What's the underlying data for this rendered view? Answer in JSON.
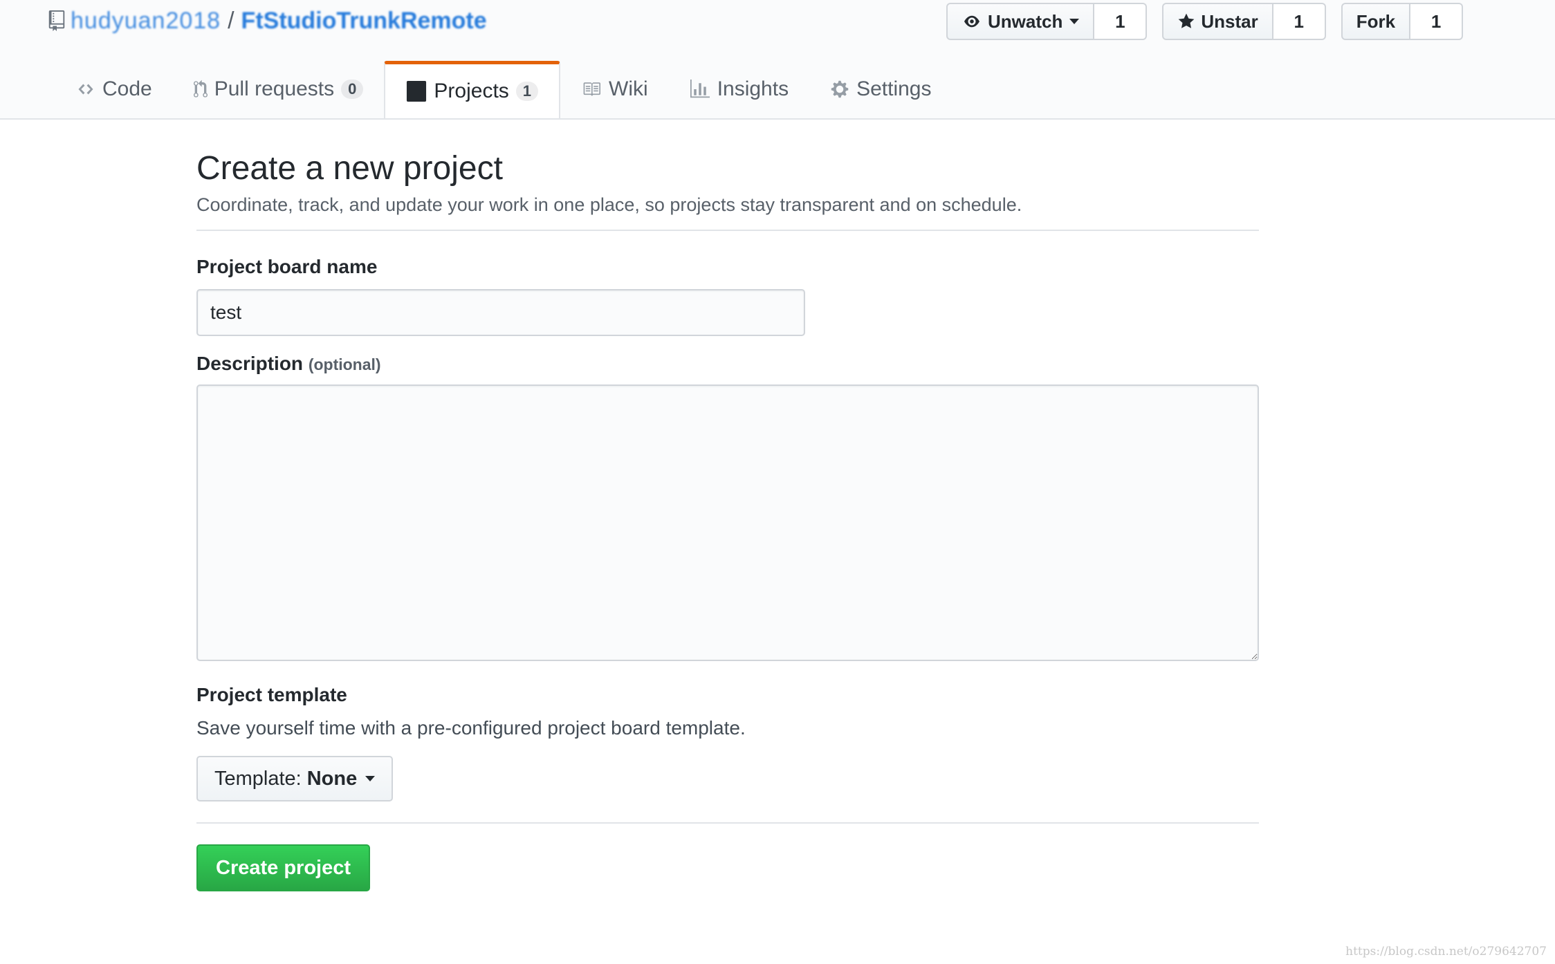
{
  "repo": {
    "owner": "hudyuan2018",
    "separator": "/",
    "name": "FtStudioTrunkRemote"
  },
  "actions": {
    "watch": {
      "label": "Unwatch",
      "count": "1"
    },
    "star": {
      "label": "Unstar",
      "count": "1"
    },
    "fork": {
      "label": "Fork",
      "count": "1"
    }
  },
  "tabs": [
    {
      "label": "Code"
    },
    {
      "label": "Pull requests",
      "count": "0"
    },
    {
      "label": "Projects",
      "count": "1",
      "selected": true
    },
    {
      "label": "Wiki"
    },
    {
      "label": "Insights"
    },
    {
      "label": "Settings"
    }
  ],
  "page": {
    "title": "Create a new project",
    "subtitle": "Coordinate, track, and update your work in one place, so projects stay transparent and on schedule."
  },
  "form": {
    "name_label": "Project board name",
    "name_value": "test",
    "description_label": "Description",
    "description_optional": "(optional)",
    "description_value": "",
    "template_label": "Project template",
    "template_note": "Save yourself time with a pre-configured project board template.",
    "template_prefix": "Template:",
    "template_value": "None",
    "submit_label": "Create project"
  },
  "watermark": "https://blog.csdn.net/o279642707",
  "colors": {
    "link": "#0366d6",
    "selected_tab_border": "#e36209",
    "primary_button": "#28a745"
  }
}
